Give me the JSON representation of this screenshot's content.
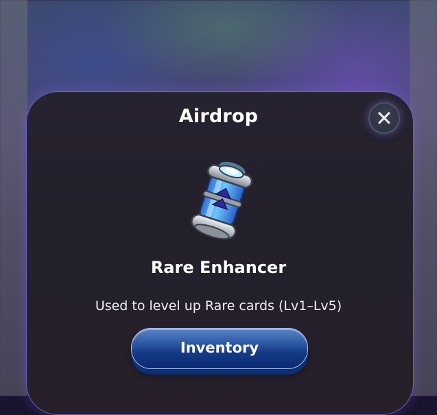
{
  "dialog": {
    "title": "Airdrop",
    "close_icon": "close-icon",
    "item": {
      "icon": "rare-enhancer-capsule-icon",
      "name": "Rare Enhancer",
      "description": "Used to level up Rare cards (Lv1–Lv5)"
    },
    "primary_button_label": "Inventory"
  },
  "colors": {
    "panel_border": "#6d5fc4",
    "button_fill": "#163b86",
    "capsule_glass": "#4aa8f0",
    "arrow": "#2d2a9a"
  }
}
